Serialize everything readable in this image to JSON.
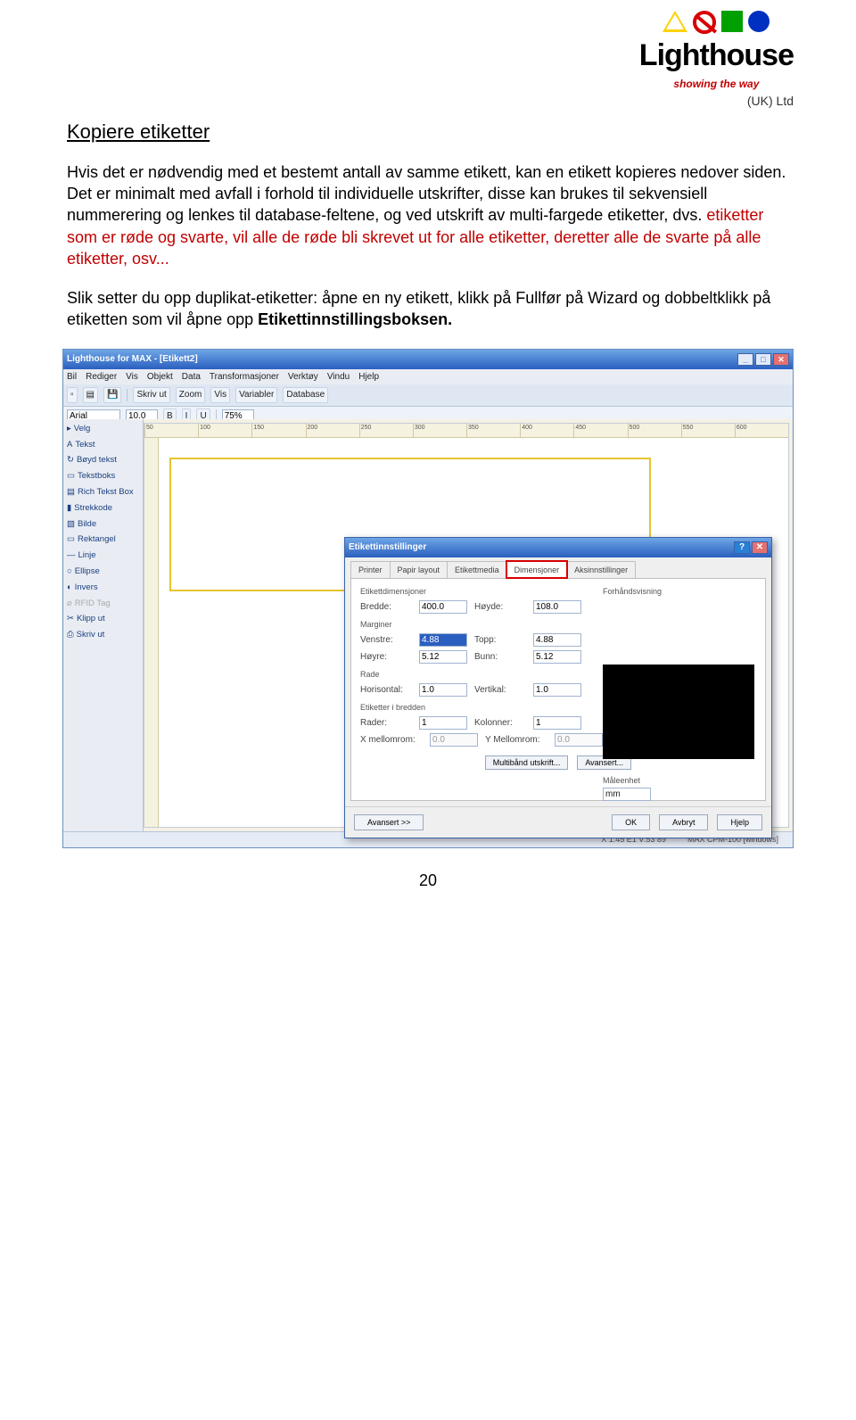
{
  "logo": {
    "name": "Lighthouse",
    "tagline": "showing the way",
    "suffix": "(UK) Ltd"
  },
  "heading": "Kopiere etiketter",
  "para1": "Hvis det er nødvendig med et bestemt antall av samme etikett, kan en etikett kopieres nedover siden. Det er minimalt med avfall i forhold til individuelle utskrifter, disse kan brukes til sekvensiell nummerering og lenkes til database-feltene, og ved utskrift av multi-fargede etiketter, dvs. ",
  "para1_red": "etiketter som er røde og svarte, vil alle de røde bli skrevet ut for alle etiketter, deretter alle de svarte på alle etiketter, osv...",
  "para2_a": "Slik setter du opp duplikat-etiketter: åpne en ny etikett, klikk på Fullfør på Wizard og dobbeltklikk på etiketten som vil åpne opp ",
  "para2_b": "Etikettinnstillingsboksen.",
  "app": {
    "title": "Lighthouse for MAX - [Etikett2]",
    "menu": [
      "Bil",
      "Rediger",
      "Vis",
      "Objekt",
      "Data",
      "Transformasjoner",
      "Verktøy",
      "Vindu",
      "Hjelp"
    ],
    "toolbar": {
      "print": "Skriv ut",
      "zoom": "Zoom",
      "view": "Vis",
      "vars": "Variabler",
      "db": "Database"
    },
    "font": {
      "name": "Arial",
      "size": "10.0",
      "zoom": "75%"
    },
    "sidebar": [
      "Velg",
      "Tekst",
      "Bøyd tekst",
      "Tekstboks",
      "Rich Tekst Box",
      "Strekkode",
      "Bilde",
      "Rektangel",
      "Linje",
      "Ellipse",
      "Invers",
      "RFID Tag",
      "Klipp ut",
      "Skriv ut"
    ],
    "statusbar": {
      "left": "X 1:45 E1 V:53 89",
      "right": "MAX CPM-100 [windows]"
    }
  },
  "dialog": {
    "title": "Etikettinnstillinger",
    "tabs": [
      "Printer",
      "Papir layout",
      "Etikettmedia",
      "Dimensjoner",
      "Aksinnstillinger"
    ],
    "activeTab": 3,
    "groups": {
      "dim": {
        "title": "Etikettdimensjoner",
        "width_label": "Bredde:",
        "width": "400.0",
        "height_label": "Høyde:",
        "height": "108.0"
      },
      "margins": {
        "title": "Marginer",
        "left_label": "Venstre:",
        "left": "4.88",
        "top_label": "Topp:",
        "top": "4.88",
        "right_label": "Høyre:",
        "right": "5.12",
        "bottom_label": "Bunn:",
        "bottom": "5.12"
      },
      "rade": {
        "title": "Rade",
        "h_label": "Horisontal:",
        "h": "1.0",
        "v_label": "Vertikal:",
        "v": "1.0"
      },
      "grid": {
        "title": "Etiketter i bredden",
        "rows_label": "Rader:",
        "rows": "1",
        "cols_label": "Kolonner:",
        "cols": "1",
        "xgap_label": "X mellomrom:",
        "xgap": "0.0",
        "ygap_label": "Y Mellomrom:",
        "ygap": "0.0"
      }
    },
    "multi_btn": "Multibånd utskrift...",
    "adv_btn": "Avansert...",
    "preview_label": "Forhåndsvisning",
    "unit_label": "Måleenhet",
    "unit_value": "mm",
    "bottom": {
      "advanced": "Avansert >>",
      "ok": "OK",
      "cancel": "Avbryt",
      "help": "Hjelp"
    }
  },
  "pagenum": "20"
}
